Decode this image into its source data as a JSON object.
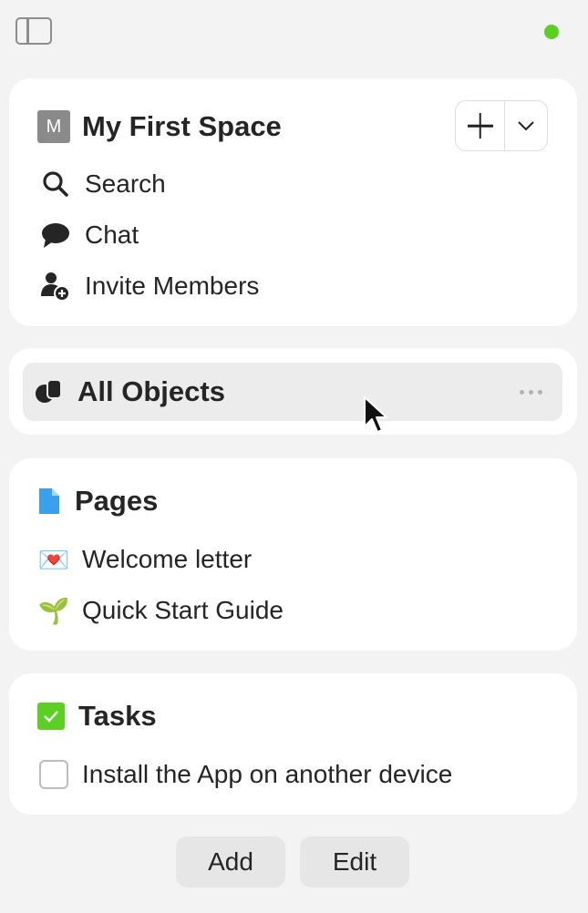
{
  "status": {
    "dot_color": "#5cd022"
  },
  "space": {
    "avatar_letter": "M",
    "name": "My First Space",
    "nav": [
      {
        "label": "Search",
        "icon": "search-icon"
      },
      {
        "label": "Chat",
        "icon": "chat-bubble-icon"
      },
      {
        "label": "Invite Members",
        "icon": "add-user-icon"
      }
    ]
  },
  "objects": {
    "label": "All Objects",
    "icon": "objects-icon"
  },
  "pages": {
    "title": "Pages",
    "icon": "page-icon",
    "items": [
      {
        "emoji": "💌",
        "label": "Welcome letter"
      },
      {
        "emoji": "🌱",
        "label": "Quick Start Guide"
      }
    ]
  },
  "tasks": {
    "title": "Tasks",
    "items": [
      {
        "label": "Install the App on another device",
        "done": false
      }
    ]
  },
  "footer": {
    "add_label": "Add",
    "edit_label": "Edit"
  },
  "colors": {
    "accent_green": "#5cd022",
    "page_icon_blue": "#3aa0ee"
  }
}
